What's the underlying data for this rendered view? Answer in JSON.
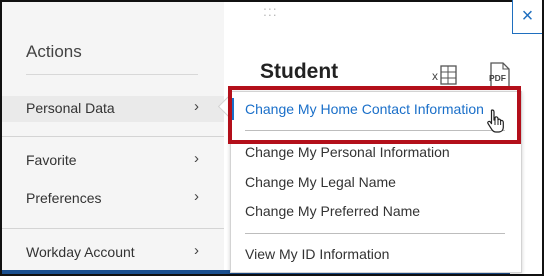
{
  "panel": {
    "title": "Actions",
    "items": [
      {
        "label": "Personal Data"
      },
      {
        "label": "Favorite"
      },
      {
        "label": "Preferences"
      },
      {
        "label": "Workday Account"
      }
    ]
  },
  "header": {
    "title": "Student",
    "grip": ":::",
    "close": "×",
    "excel_icon": "excel-export-icon",
    "pdf_icon": "pdf-export-icon",
    "pdf_text": "PDF"
  },
  "submenu": {
    "items": [
      {
        "label": "Change My Home Contact Information"
      },
      {
        "label": "Change My Personal Information"
      },
      {
        "label": "Change My Legal Name"
      },
      {
        "label": "Change My Preferred Name"
      },
      {
        "label": "View My ID Information"
      }
    ]
  },
  "colors": {
    "accent": "#1a6fc9",
    "highlight": "#b30f1a",
    "panel_bg": "#f5f5f5"
  }
}
